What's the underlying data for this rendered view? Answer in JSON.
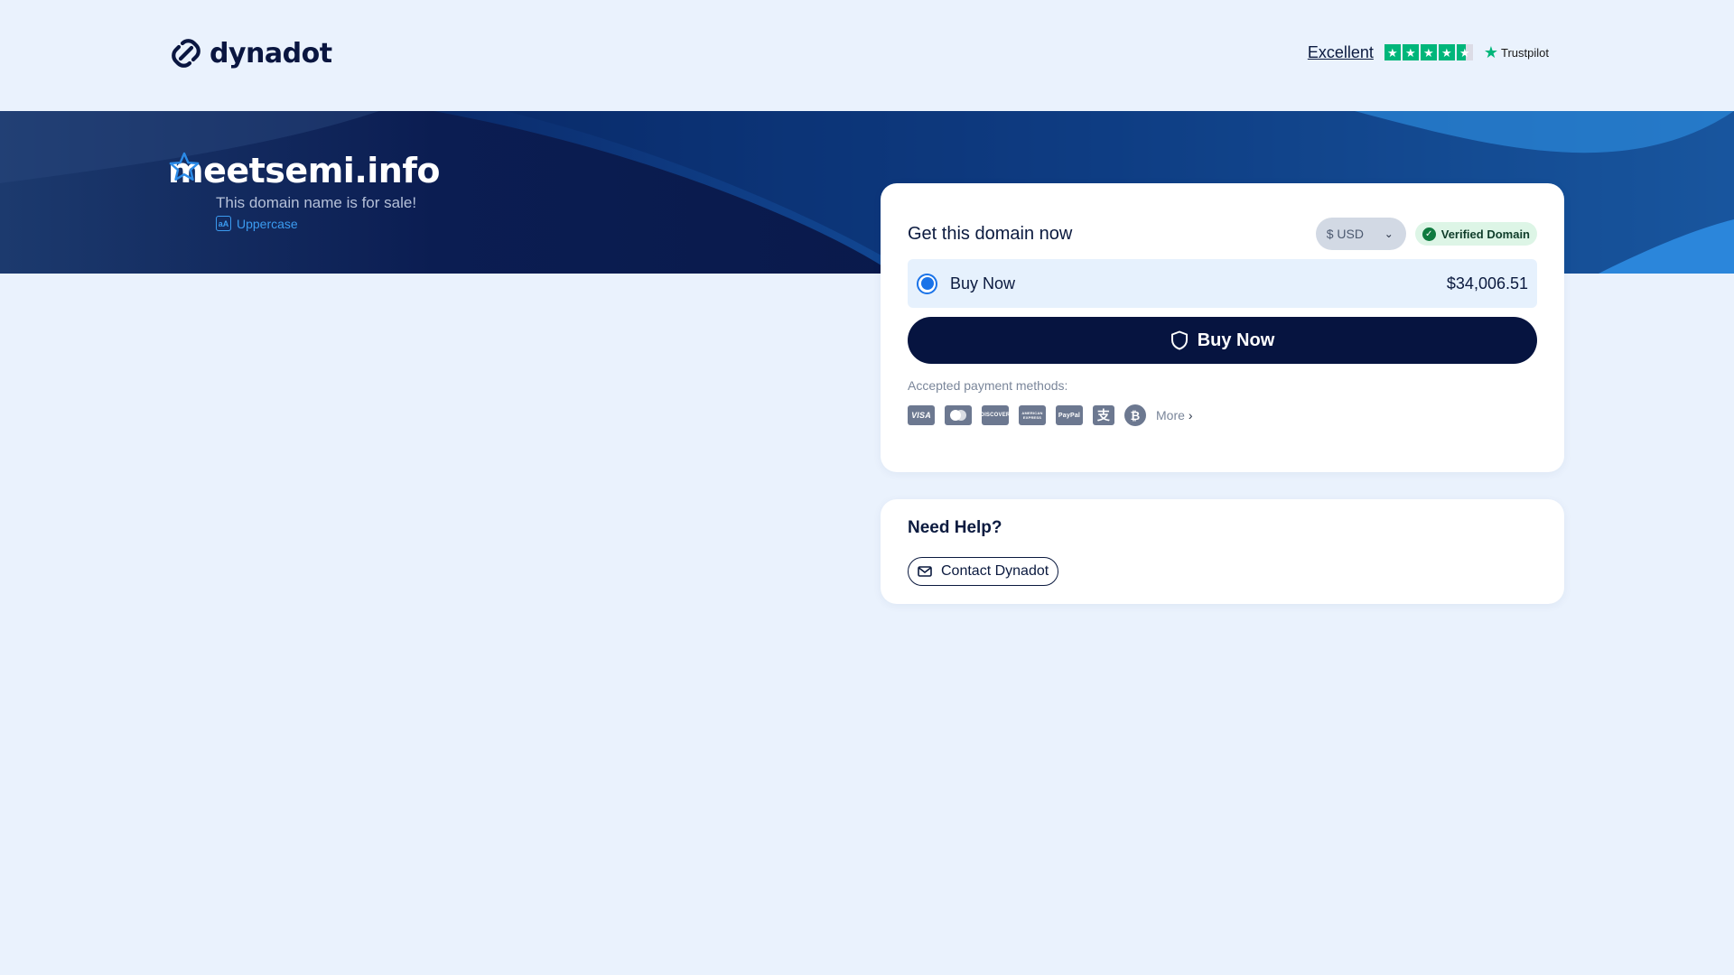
{
  "header": {
    "logo_text": "dynadot",
    "trustpilot": {
      "rating_label": "Excellent",
      "stars": 4.5,
      "brand": "Trustpilot"
    }
  },
  "hero": {
    "domain": "meetsemi.info",
    "subtitle": "This domain name is for sale!",
    "uppercase_label": "Uppercase",
    "uppercase_icon_text": "aA"
  },
  "purchase": {
    "title": "Get this domain now",
    "currency": "$ USD",
    "verified_label": "Verified Domain",
    "option": {
      "label": "Buy Now",
      "price": "$34,006.51",
      "selected": true
    },
    "buy_button_label": "Buy Now",
    "payment_label": "Accepted payment methods:",
    "payment_methods": [
      {
        "name": "visa",
        "text": "VISA"
      },
      {
        "name": "mastercard",
        "text": ""
      },
      {
        "name": "discover",
        "text": "DISCOVER"
      },
      {
        "name": "amex",
        "text": "AMERICAN EXPRESS"
      },
      {
        "name": "paypal",
        "text": "PayPal"
      },
      {
        "name": "alipay",
        "text": "支"
      },
      {
        "name": "bitcoin",
        "text": "₿"
      }
    ],
    "more_label": "More"
  },
  "help": {
    "title": "Need Help?",
    "contact_label": "Contact Dynadot"
  },
  "colors": {
    "page_bg": "#eaf2fd",
    "hero_bg": "#061440",
    "accent": "#1a73e8",
    "trustpilot_green": "#00b67a",
    "verified_bg": "#ddf5e6"
  }
}
